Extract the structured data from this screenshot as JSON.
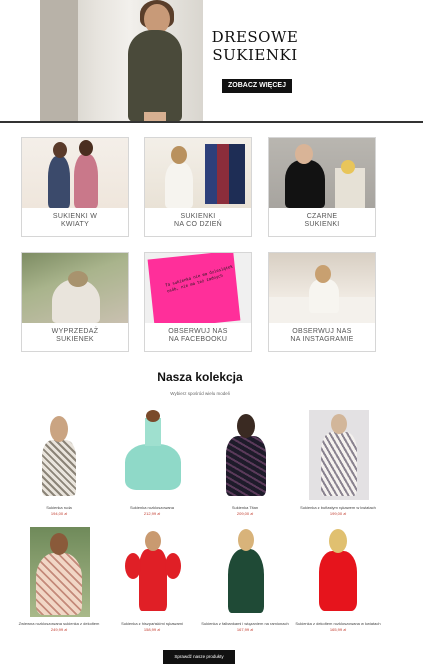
{
  "hero": {
    "title_line1": "DRESOWE",
    "title_line2": "SUKIENKI",
    "button_label": "ZOBACZ WIĘCEJ"
  },
  "categories": [
    {
      "line1": "SUKIENKI W",
      "line2": "KWIATY"
    },
    {
      "line1": "SUKIENKI",
      "line2": "NA CO DZIEŃ"
    },
    {
      "line1": "CZARNE",
      "line2": "SUKIENKI"
    },
    {
      "line1": "WYPRZEDAŻ",
      "line2": "SUKIENEK"
    },
    {
      "line1": "OBSERWUJ NAS",
      "line2": "NA FACEBOOKU"
    },
    {
      "line1": "OBSERWUJ NAS",
      "line2": "NA INSTAGRAMIE"
    }
  ],
  "postit_text": "Ta sukienka nie ma dziesiątek osób, nie ma też żadnych",
  "collection": {
    "title": "Nasza kolekcja",
    "subtitle": "Wybierz spośród wielu modeli"
  },
  "products": [
    {
      "name": "Sukienka ruda",
      "price": "194,00 zł"
    },
    {
      "name": "Sukienka rozkloszowana",
      "price": "212,99 zł"
    },
    {
      "name": "Sukienka Titan",
      "price": "209,00 zł"
    },
    {
      "name": "Sukienka z bufiastym rękawem w kwiatach",
      "price": "199,00 zł"
    },
    {
      "name": "Zwiewna rozkloszowana sukienka z dekoltem",
      "price": "249,99 zł"
    },
    {
      "name": "Sukienka z hiszpańskimi rękawami",
      "price": "158,99 zł"
    },
    {
      "name": "Sukienka z falbankami i wiązaniem na ramionach",
      "price": "167,99 zł"
    },
    {
      "name": "Sukienka z dekoltem rozkloszowana w kwiatach",
      "price": "165,99 zł"
    }
  ],
  "cta_label": "Sprawdź nasze produkty",
  "colors": {
    "accent": "#111111",
    "price": "#c0392b",
    "postit": "#ff2f9a"
  }
}
